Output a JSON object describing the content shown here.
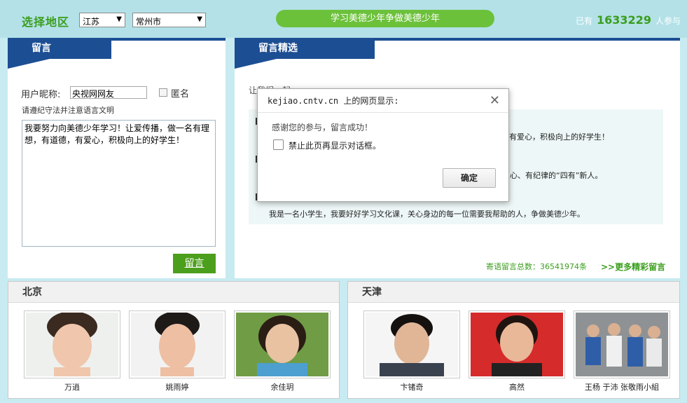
{
  "header": {
    "region_label": "选择地区",
    "province": "江苏",
    "city": "常州市",
    "slogan": "学习美德少年争做美德少年",
    "participants_prefix": "已有",
    "participants_count": "1633229",
    "participants_suffix": "人参与"
  },
  "left": {
    "title": "留言",
    "nickname_label": "用户昵称:",
    "nickname_value": "央视网网友",
    "anonymous_label": "匿名",
    "rules_text": "请遵纪守法并注意语言文明",
    "message_text": "我要努力向美德少年学习！让爱传播，做一名有理想，有道德，有爱心，积极向上的好学生！",
    "submit_label": "留言"
  },
  "right": {
    "title": "留言精选",
    "partial_top_text": "让我们一起",
    "items": [
      {
        "text": "有爱心，积极向上的好学生！"
      },
      {
        "text": "心、有纪律的“四有”新人。"
      },
      {
        "text": "我是一名小学生，我要好好学习文化课，关心身边的每一位需要我帮助的人，争做美德少年。"
      }
    ],
    "total_text": "寄语留言总数：36541974条",
    "more_text": ">>更多精彩留言"
  },
  "cities": [
    {
      "name": "北京",
      "people": [
        "万逍",
        "姚雨婷",
        "余佳玥"
      ]
    },
    {
      "name": "天津",
      "people": [
        "卞锗奇",
        "高然",
        "王杨 于沛 张敬雨小組"
      ]
    }
  ],
  "dialog": {
    "title": "kejiao.cntv.cn 上的网页显示:",
    "message": "感谢您的参与，留言成功！",
    "checkbox_label": "禁止此页再显示对话框。",
    "ok_label": "确定"
  },
  "colors": {
    "accent_green": "#3a9e1c",
    "ribbon_blue": "#1c4e93",
    "topbar": "#b4e1e8"
  }
}
